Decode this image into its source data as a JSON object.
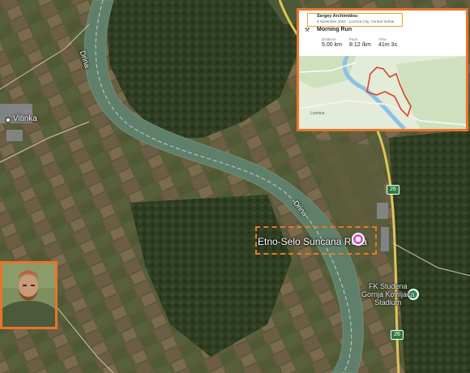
{
  "map": {
    "river_label_1": "Drina",
    "river_label_2": "Drina",
    "city_label": "Vitinka",
    "poi_label": "Etno-Selo Suncana Reka",
    "road_number_1": "26",
    "road_number_2": "26",
    "fk_label_line1": "FK Studena",
    "fk_label_line2": "Gornja Koviljača",
    "fk_label_line3": "Stadium"
  },
  "activity": {
    "user_name": "Sergey Archimidou",
    "meta": "8 November 2022 · Loznica City, Central Serbia",
    "title": "Morning Run",
    "stats": [
      {
        "label": "Distance",
        "value": "5.00 km"
      },
      {
        "label": "Pace",
        "value": "8:12 /km"
      },
      {
        "label": "Time",
        "value": "41m 3s"
      }
    ],
    "map_town_label": "Loznica"
  },
  "colors": {
    "accent_border": "#e8742a",
    "poi_pin": "#d14fd6",
    "route": "#d8442a"
  }
}
